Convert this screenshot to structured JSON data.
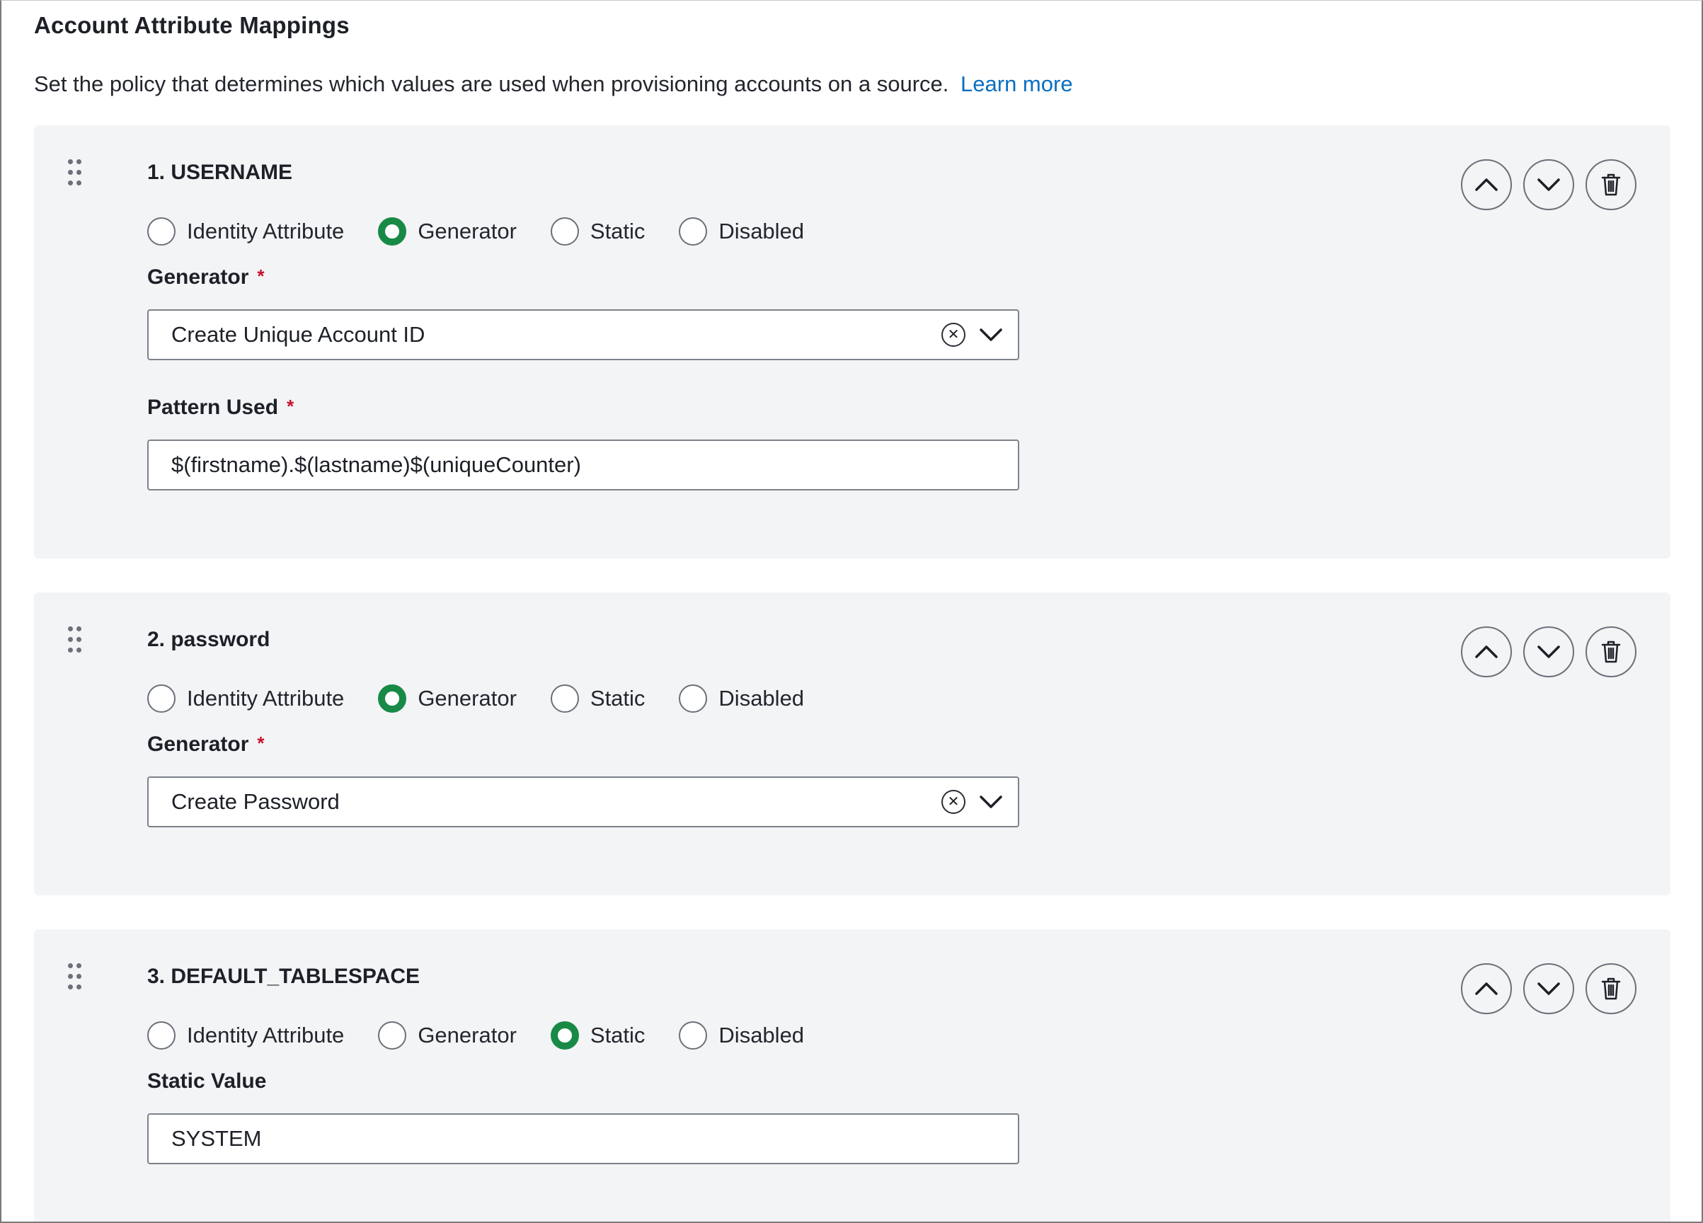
{
  "header": {
    "title": "Account Attribute Mappings",
    "description": "Set the policy that determines which values are used when provisioning accounts on a source.",
    "learn_more": "Learn more"
  },
  "radio_options": [
    "Identity Attribute",
    "Generator",
    "Static",
    "Disabled"
  ],
  "colors": {
    "accent_green": "#188a46",
    "link_blue": "#0a6fc2",
    "required_red": "#c8102e",
    "card_bg": "#f3f4f6"
  },
  "mappings": [
    {
      "title": "1. USERNAME",
      "selected": "Generator",
      "fields": [
        {
          "label": "Generator",
          "required_mark": "*",
          "value": "Create Unique Account ID",
          "type": "select"
        },
        {
          "label": "Pattern Used",
          "required_mark": "*",
          "value": "$(firstname).$(lastname)$(uniqueCounter)",
          "type": "text"
        }
      ]
    },
    {
      "title": "2. password",
      "selected": "Generator",
      "fields": [
        {
          "label": "Generator",
          "required_mark": "*",
          "value": "Create Password",
          "type": "select"
        }
      ]
    },
    {
      "title": "3. DEFAULT_TABLESPACE",
      "selected": "Static",
      "fields": [
        {
          "label": "Static Value",
          "value": "SYSTEM",
          "type": "text"
        }
      ]
    }
  ],
  "icons": {
    "drag": "drag-handle-icon",
    "up": "chevron-up-icon",
    "down": "chevron-down-icon",
    "delete": "trash-icon",
    "clear": "clear-circle-icon"
  }
}
